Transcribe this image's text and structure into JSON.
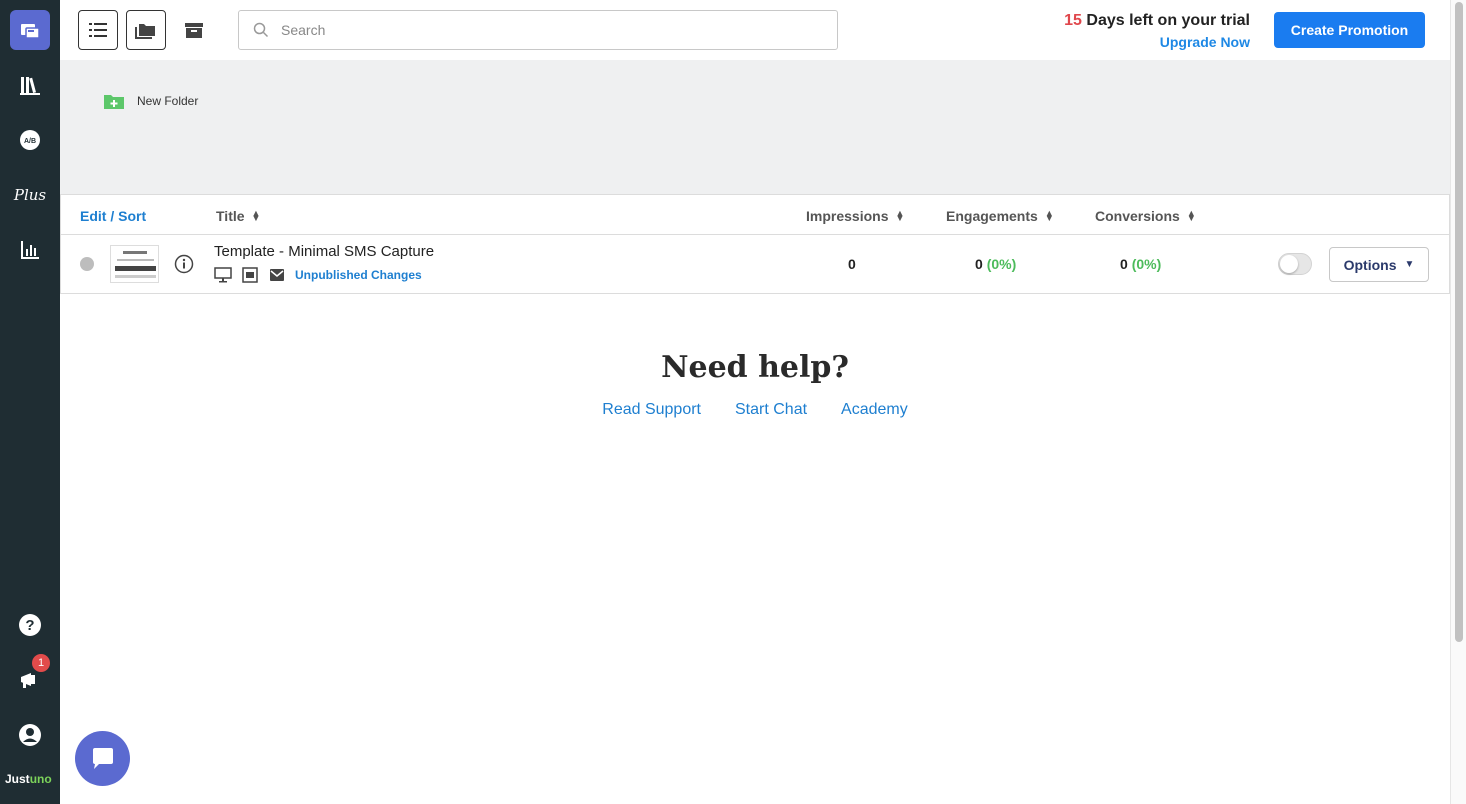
{
  "sidebar": {
    "items": [
      {
        "name": "promotions",
        "icon": "promotions-icon",
        "active": true
      },
      {
        "name": "library",
        "icon": "library-icon"
      },
      {
        "name": "ab-test",
        "icon": "ab-test-icon",
        "label": "A/B"
      },
      {
        "name": "plus",
        "icon": "plus-icon",
        "label": "Plus"
      },
      {
        "name": "analytics",
        "icon": "bar-chart-icon"
      },
      {
        "name": "help",
        "icon": "question-icon"
      },
      {
        "name": "announcements",
        "icon": "megaphone-icon",
        "badge": "1"
      },
      {
        "name": "account",
        "icon": "user-icon"
      }
    ],
    "logo": {
      "part1": "Just",
      "part2": "uno"
    }
  },
  "topbar": {
    "search_placeholder": "Search",
    "trial_days": "15",
    "trial_text": " Days left on your trial",
    "upgrade_label": "Upgrade Now",
    "create_label": "Create Promotion"
  },
  "folders": {
    "new_folder_label": "New Folder"
  },
  "table": {
    "headers": {
      "edit_sort": "Edit / Sort",
      "title": "Title",
      "impressions": "Impressions",
      "engagements": "Engagements",
      "conversions": "Conversions"
    },
    "rows": [
      {
        "title": "Template - Minimal SMS Capture",
        "status_text": "Unpublished Changes",
        "impressions": "0",
        "engagements": "0",
        "engagements_pct": "(0%)",
        "conversions": "0",
        "conversions_pct": "(0%)",
        "options_label": "Options"
      }
    ]
  },
  "help": {
    "title": "Need help?",
    "links": [
      "Read Support",
      "Start Chat",
      "Academy"
    ]
  },
  "colors": {
    "sidebar_bg": "#1f2d33",
    "accent": "#1a7cf0",
    "active_nav": "#5b6ad0",
    "trial_red": "#e0474c",
    "success_green": "#4cbb5b"
  }
}
